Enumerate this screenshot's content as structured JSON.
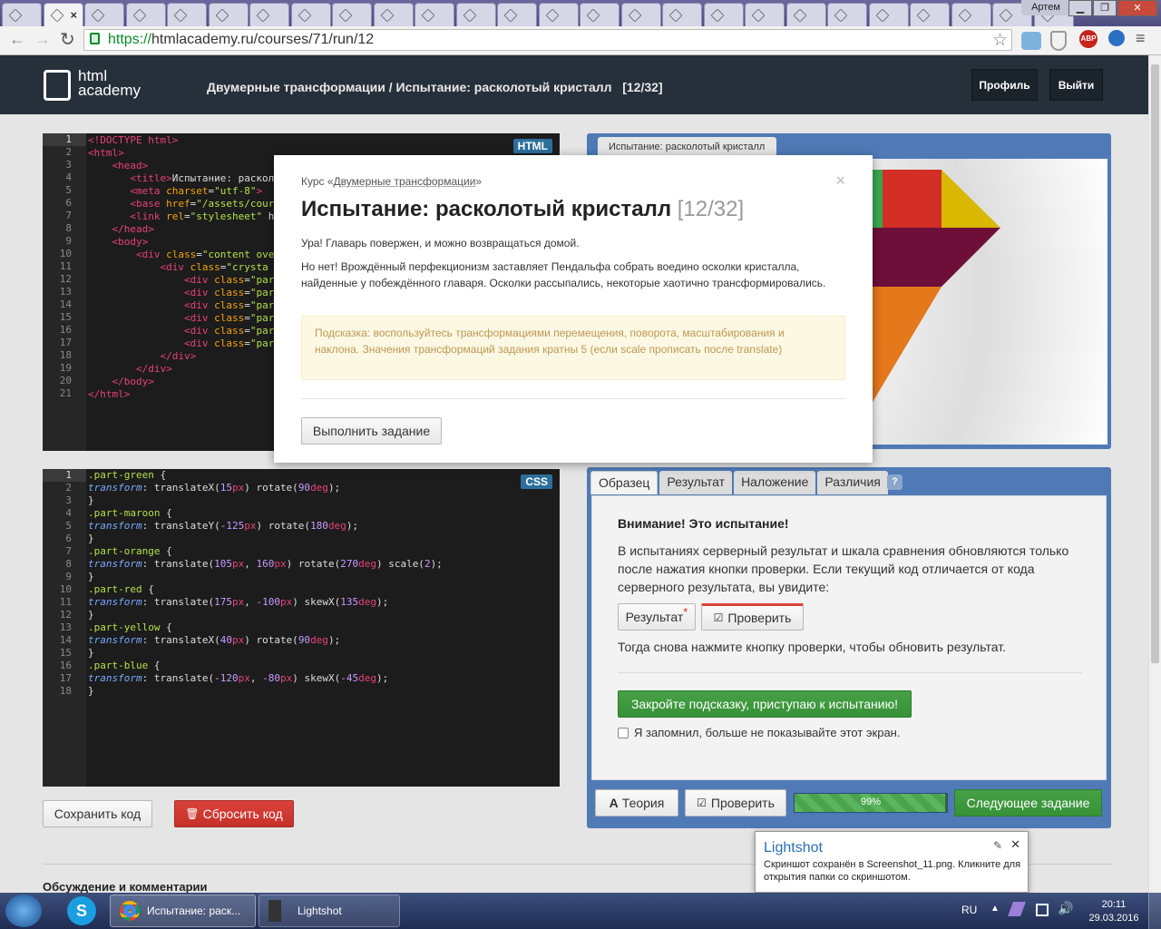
{
  "browser": {
    "user_name": "Артем",
    "url_scheme": "https://",
    "url_rest": "htmlacademy.ru/courses/71/run/12",
    "tab_count": 26
  },
  "site": {
    "logo_line1": "html",
    "logo_line2": "academy",
    "breadcrumb_course": "Двумерные трансформации",
    "breadcrumb_sep": " / ",
    "breadcrumb_task": "Испытание: расколотый кристалл",
    "breadcrumb_progress": "[12/32]",
    "profile_label": "Профиль",
    "logout_label": "Выйти"
  },
  "html_editor": {
    "badge": "HTML",
    "line_count": 21
  },
  "css_editor": {
    "badge": "CSS",
    "line_count": 18
  },
  "preview": {
    "tab_label": "Испытание: расколотый кристалл",
    "colors": {
      "green": "#3aa84f",
      "red": "#d32f26",
      "yellow": "#d8b800",
      "maroon": "#6e0f3a",
      "orange": "#e5781b"
    }
  },
  "result_panel": {
    "tabs": [
      "Образец",
      "Результат",
      "Наложение",
      "Различия"
    ],
    "help": "?",
    "warning_title": "Внимание! Это испытание!",
    "warning_text": "В испытаниях серверный результат и шкала сравнения обновляются только после нажатия кнопки проверки. Если текущий код отличается от кода серверного результата, вы увидите:",
    "result_btn": "Результат",
    "asterisk": "*",
    "check_btn": "Проверить",
    "after_text": "Тогда снова нажмите кнопку проверки, чтобы обновить результат.",
    "close_hint_btn": "Закройте подсказку, приступаю к испытанию!",
    "remember_label": "Я запомнил, больше не показывайте этот экран."
  },
  "bottom_bar": {
    "theory_btn": "Теория",
    "check_btn": "Проверить",
    "progress_text": "99%",
    "progress_value": 0.99,
    "next_btn": "Следующее задание"
  },
  "editor_actions": {
    "save_btn": "Сохранить код",
    "reset_btn": "Сбросить код"
  },
  "comments_heading": "Обсуждение и комментарии",
  "modal": {
    "course_prefix": "Курс «",
    "course_link": "Двумерные трансформации",
    "course_suffix": "»",
    "close": "×",
    "title": "Испытание: расколотый кристалл",
    "title_progress": "[12/32]",
    "p1": "Ура! Главарь повержен, и можно возвращаться домой.",
    "p2": "Но нет! Врождённый перфекционизм заставляет Пендальфа собрать воедино осколки кристалла, найденные у побеждённого главаря. Осколки рассыпались, некоторые хаотично трансформировались.",
    "hint": "Подсказка: воспользуйтесь трансформациями перемещения, поворота, масштабирования и наклона. Значения трансформаций задания кратны 5 (если scale прописать после translate)",
    "action_btn": "Выполнить задание"
  },
  "lightshot": {
    "title": "Lightshot",
    "message": "Скриншот сохранён в Screenshot_11.png. Кликните для открытия папки со скриншотом."
  },
  "taskbar": {
    "chrome_label": "Испытание: раск...",
    "lightshot_label": "Lightshot",
    "lang": "RU",
    "time": "20:11",
    "date": "29.03.2016"
  }
}
